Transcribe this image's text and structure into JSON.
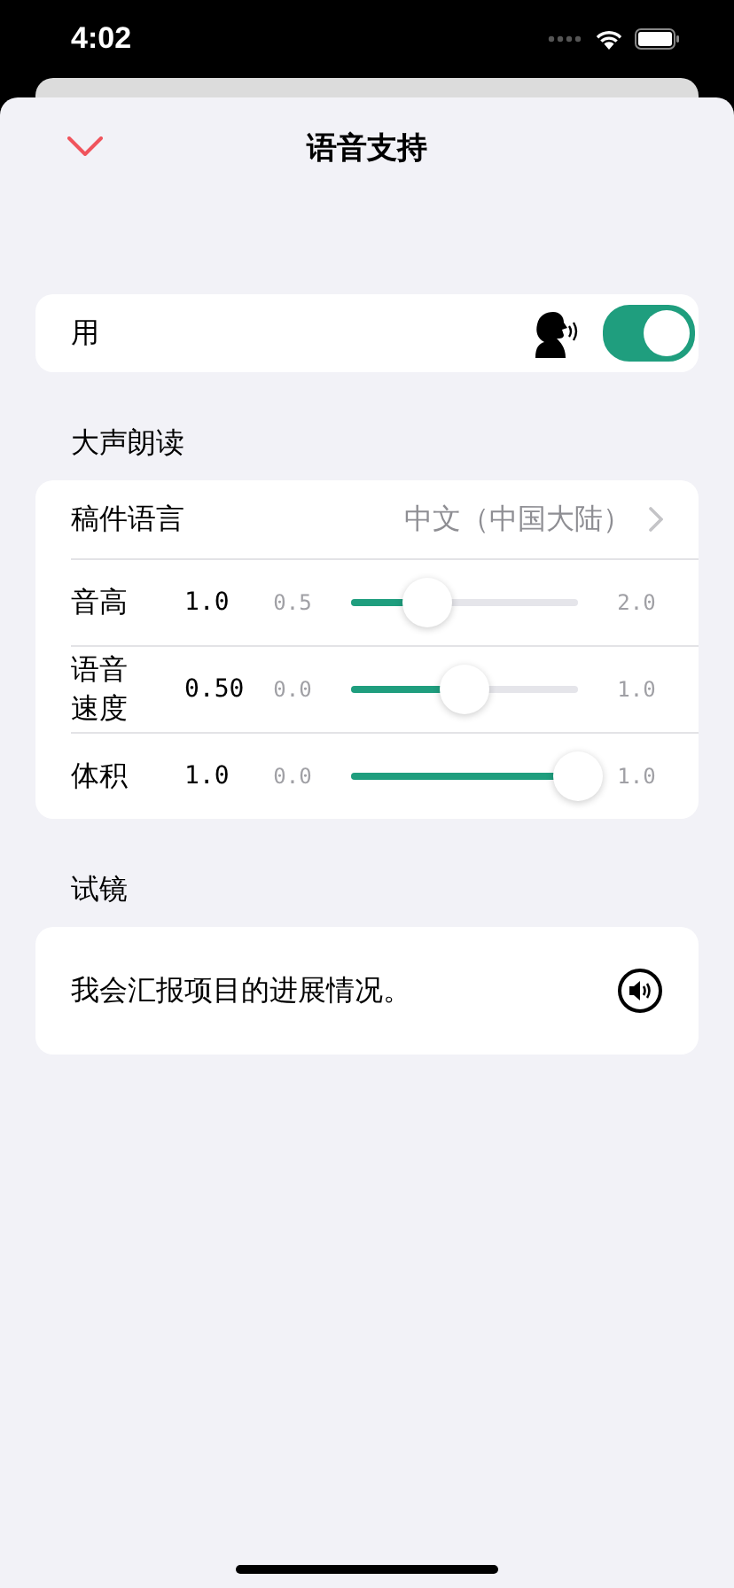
{
  "status_bar": {
    "time": "4:02"
  },
  "header": {
    "title": "语音支持"
  },
  "enable": {
    "label": "用",
    "on": true
  },
  "read_aloud": {
    "heading": "大声朗读",
    "language": {
      "label": "稿件语言",
      "value": "中文（中国大陆）"
    },
    "sliders": [
      {
        "label": "音高",
        "reading": "1.0",
        "min": "0.5",
        "max": "2.0",
        "level": 0.333
      },
      {
        "label": "语音速度",
        "reading": "0.50",
        "min": "0.0",
        "max": "1.0",
        "level": 0.5
      },
      {
        "label": "体积",
        "reading": "1.0",
        "min": "0.0",
        "max": "1.0",
        "level": 1
      }
    ]
  },
  "preview": {
    "heading": "试镜",
    "text": "我会汇报项目的进展情况。"
  }
}
